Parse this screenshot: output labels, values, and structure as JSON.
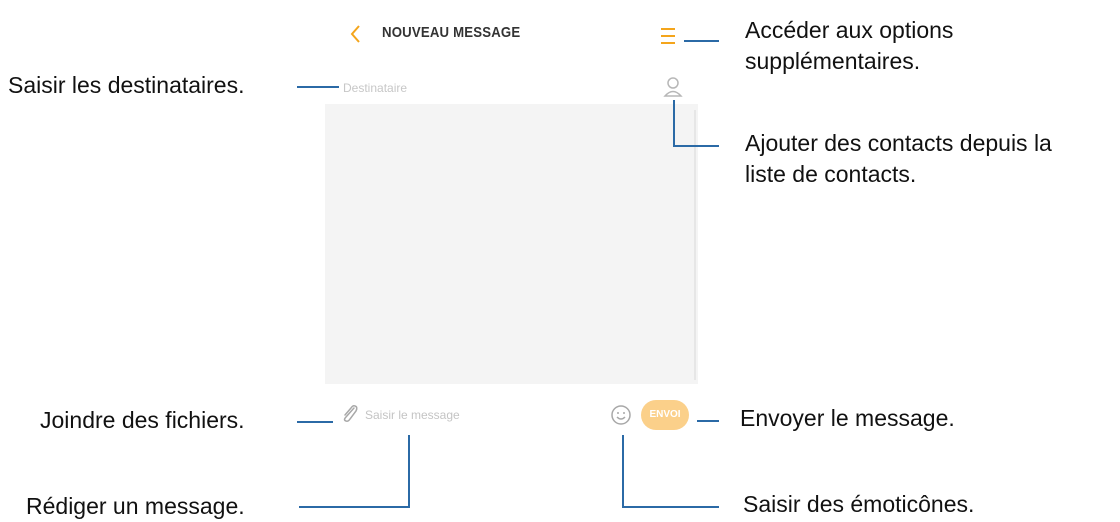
{
  "app": {
    "title": "NOUVEAU MESSAGE",
    "accent_color": "#f4a51c",
    "icons": {
      "back": "chevron-left-icon",
      "menu": "menu-icon",
      "contacts": "contact-icon",
      "attach": "paperclip-icon",
      "emoji": "smiley-icon"
    },
    "recipient": {
      "placeholder": "Destinataire"
    },
    "compose": {
      "placeholder": "Saisir le message",
      "send_label": "ENVOI"
    }
  },
  "callouts": {
    "options_line1": "Accéder aux options",
    "options_line2": "supplémentaires.",
    "recipients": "Saisir les destinataires.",
    "contacts_line1": "Ajouter des contacts depuis la",
    "contacts_line2": "liste de contacts.",
    "attach": "Joindre des fichiers.",
    "send": "Envoyer le message.",
    "compose": "Rédiger un message.",
    "emoji": "Saisir des émoticônes."
  },
  "callout_line_color": "#2b6aa6"
}
